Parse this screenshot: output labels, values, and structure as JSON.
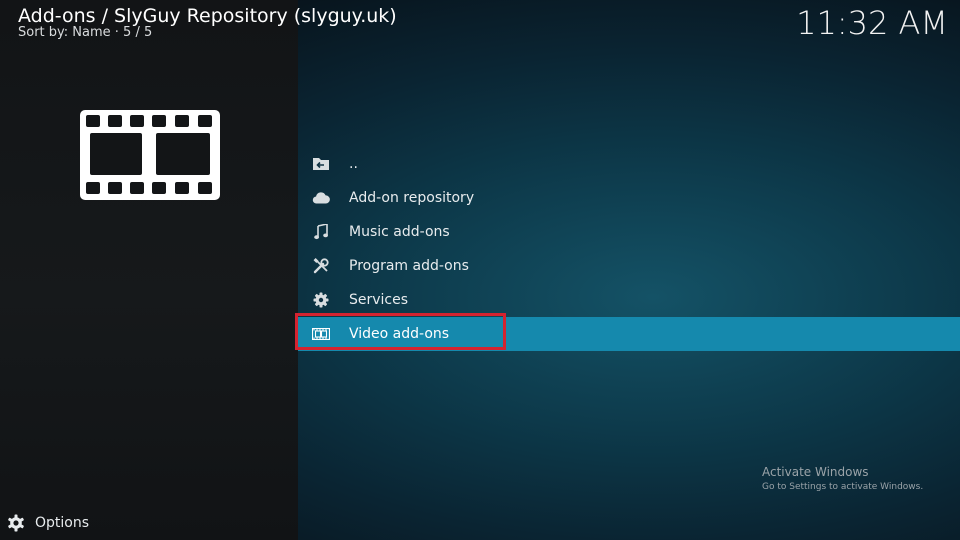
{
  "header": {
    "title": "Add-ons / SlyGuy Repository (slyguy.uk)",
    "subtitle": "Sort by: Name  ·  5 / 5"
  },
  "clock": "11:32 AM",
  "thumbnail_icon": "film-strip-icon",
  "list": {
    "items": [
      {
        "label": "..",
        "icon": "folder-back-icon",
        "focused": false
      },
      {
        "label": "Add-on repository",
        "icon": "cloud-icon",
        "focused": false
      },
      {
        "label": "Music add-ons",
        "icon": "music-note-icon",
        "focused": false
      },
      {
        "label": "Program add-ons",
        "icon": "tools-icon",
        "focused": false
      },
      {
        "label": "Services",
        "icon": "gear-icon",
        "focused": false
      },
      {
        "label": "Video add-ons",
        "icon": "film-icon",
        "focused": true
      }
    ]
  },
  "highlight_color": "#d42330",
  "focus_color": "#1589ad",
  "footer": {
    "options_label": "Options",
    "options_icon": "options-gear-icon"
  },
  "watermark": {
    "title": "Activate Windows",
    "subtitle": "Go to Settings to activate Windows."
  }
}
